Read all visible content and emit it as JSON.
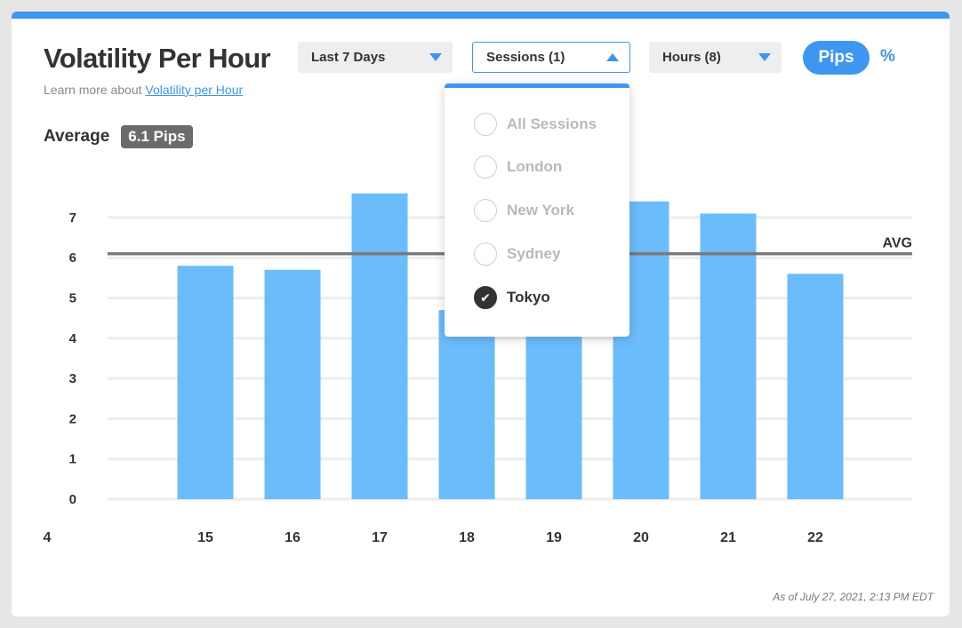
{
  "header": {
    "title": "Volatility Per Hour",
    "learn_prefix": "Learn more about",
    "learn_link": "Volatility per Hour"
  },
  "controls": {
    "range_label": "Last 7 Days",
    "sessions_label": "Sessions (1)",
    "hours_label": "Hours (8)",
    "pips_label": "Pips",
    "percent_label": "%"
  },
  "average": {
    "label": "Average",
    "value": "6.1 Pips"
  },
  "sessions_menu": {
    "items": [
      {
        "label": "All Sessions",
        "checked": false
      },
      {
        "label": "London",
        "checked": false
      },
      {
        "label": "New York",
        "checked": false
      },
      {
        "label": "Sydney",
        "checked": false
      },
      {
        "label": "Tokyo",
        "checked": true
      }
    ],
    "check_icon": "checkmark-icon"
  },
  "footer": {
    "timestamp": "As of July 27, 2021, 2:13 PM EDT"
  },
  "colors": {
    "accent": "#3d96f0",
    "bar": "#6bbcfb",
    "avg_line": "#7a7a7a",
    "grid": "#ededed"
  },
  "chart_data": {
    "type": "bar",
    "categories": [
      "15",
      "16",
      "17",
      "18",
      "19",
      "20",
      "21",
      "22"
    ],
    "values": [
      5.8,
      5.7,
      7.6,
      4.7,
      5.3,
      7.4,
      7.1,
      5.6
    ],
    "average": 6.1,
    "avg_label": "AVG",
    "yticks": [
      0,
      1,
      2,
      3,
      4,
      5,
      6,
      7
    ],
    "ylim": [
      0,
      7.8
    ],
    "stray_label": "4",
    "grid": true,
    "title": "",
    "xlabel": "",
    "ylabel": ""
  }
}
